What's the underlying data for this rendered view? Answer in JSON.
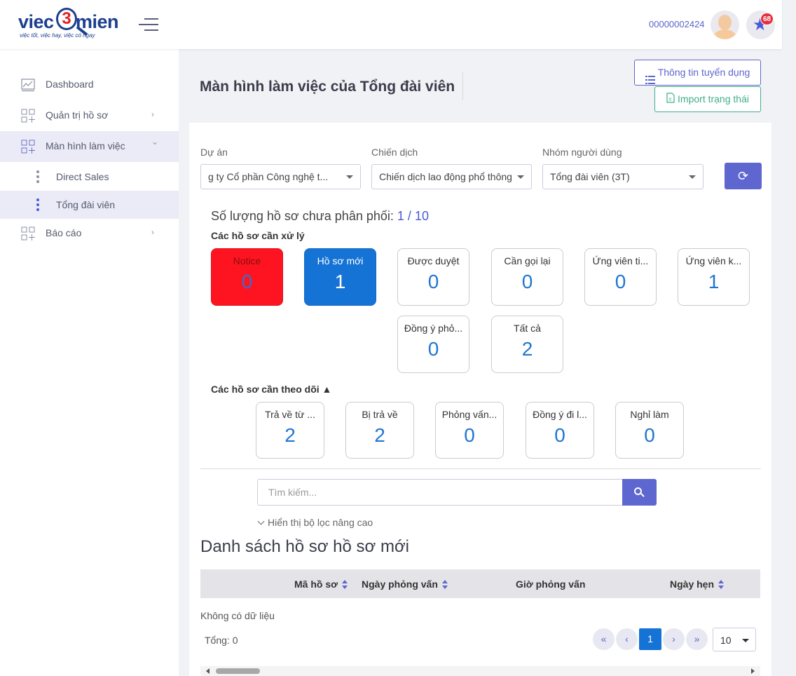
{
  "brand": {
    "part1": "viec",
    "number": "3",
    "part2": "mien",
    "tagline": "việc tốt, việc hay, việc có ngay"
  },
  "header": {
    "user_id": "00000002424",
    "notification_count": "68"
  },
  "sidebar": {
    "items": [
      {
        "label": "Dashboard"
      },
      {
        "label": "Quản trị hồ sơ",
        "chevron": "›"
      },
      {
        "label": "Màn hình làm việc",
        "chevron": "⌄"
      },
      {
        "label": "Báo cáo",
        "chevron": "›"
      }
    ],
    "sub_items": [
      {
        "label": "Direct Sales"
      },
      {
        "label": "Tổng đài viên"
      }
    ]
  },
  "page": {
    "title": "Màn hình làm việc của Tổng đài viên",
    "btn_info": "Thông tin tuyển dụng",
    "btn_import": "Import trạng thái"
  },
  "filters": {
    "project_label": "Dự án",
    "project_value": "g ty Cổ phần Công nghệ t...",
    "campaign_label": "Chiến dịch",
    "campaign_value": "Chiến dịch lao động phổ thông",
    "group_label": "Nhóm người dùng",
    "group_value": "Tổng đài viên (3T)"
  },
  "summary": {
    "label": "Số lượng hồ sơ chưa phân phối:",
    "value": "1",
    "sep": "/",
    "total": "10"
  },
  "process_section": {
    "title": "Các hồ sơ cần xử lý",
    "cards": [
      {
        "title": "Notice",
        "value": "0"
      },
      {
        "title": "Hồ sơ mới",
        "value": "1"
      },
      {
        "title": "Được duyệt",
        "value": "0"
      },
      {
        "title": "Cần gọi lại",
        "value": "0"
      },
      {
        "title": "Ứng viên ti...",
        "value": "0"
      },
      {
        "title": "Ứng viên k...",
        "value": "1"
      },
      {
        "title": "Đồng ý phỏ...",
        "value": "0"
      },
      {
        "title": "Tất cả",
        "value": "2"
      }
    ]
  },
  "follow_section": {
    "title": "Các hồ sơ cần theo dõi ▲",
    "cards": [
      {
        "title": "Trả về từ ...",
        "value": "2"
      },
      {
        "title": "Bị trả về",
        "value": "2"
      },
      {
        "title": "Phỏng vấn...",
        "value": "0"
      },
      {
        "title": "Đồng ý đi l...",
        "value": "0"
      },
      {
        "title": "Nghỉ làm",
        "value": "0"
      }
    ]
  },
  "search": {
    "placeholder": "Tìm kiếm...",
    "advanced": "Hiển thị bộ lọc nâng cao"
  },
  "table": {
    "title": "Danh sách hồ sơ hồ sơ mới",
    "columns": [
      "Mã hồ sơ",
      "Ngày phỏng vấn",
      "Giờ phỏng vấn",
      "Ngày hẹn"
    ],
    "empty": "Không có dữ liệu",
    "total": "Tổng: 0"
  },
  "pagination": {
    "first": "«",
    "prev": "‹",
    "current": "1",
    "next": "›",
    "last": "»",
    "page_size": "10"
  },
  "colors": {
    "primary": "#5e66cf",
    "notice": "#fd1420",
    "new": "#1673d6",
    "import": "#3fae8a"
  }
}
